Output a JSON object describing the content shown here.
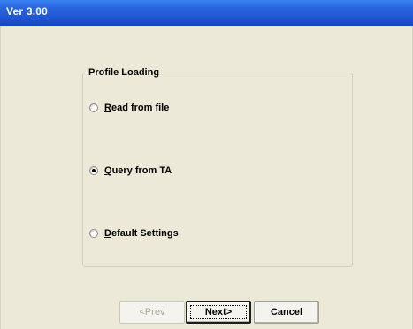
{
  "window": {
    "title": "Ver 3.00"
  },
  "group": {
    "legend": "Profile Loading",
    "options": [
      {
        "accel": "R",
        "rest": "ead from file",
        "checked": false
      },
      {
        "accel": "Q",
        "rest": "uery from TA",
        "checked": true
      },
      {
        "accel": "D",
        "rest": "efault Settings",
        "checked": false
      }
    ]
  },
  "buttons": {
    "prev_label": "<Prev",
    "prev_enabled": false,
    "next_label": "Next>",
    "next_default": true,
    "cancel_label": "Cancel"
  }
}
